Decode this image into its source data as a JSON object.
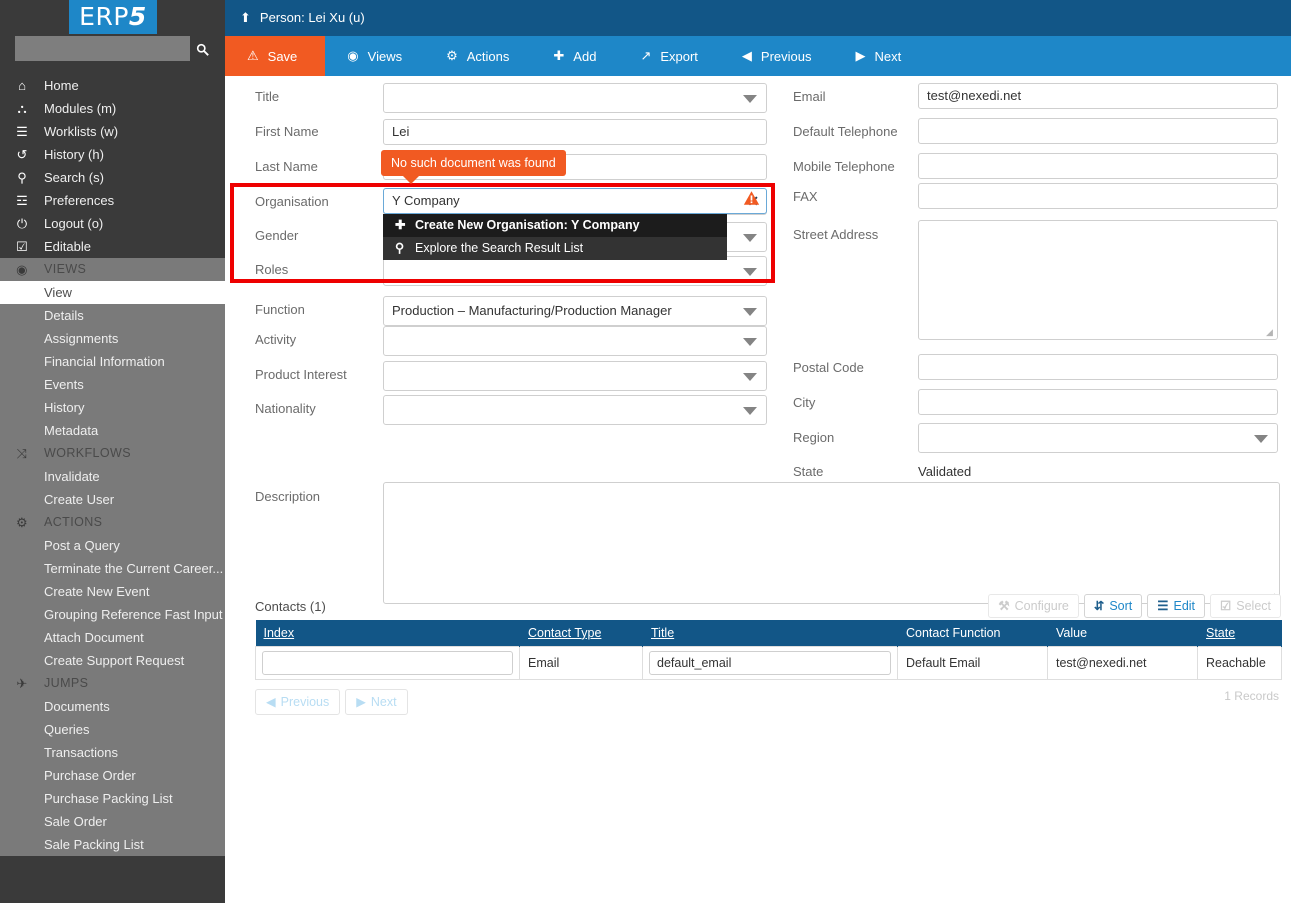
{
  "sidebar": {
    "logo": {
      "prefix": "ERP",
      "suffix": "5"
    },
    "search": {
      "value": "",
      "placeholder": "",
      "icon": "search-icon"
    },
    "nav": [
      {
        "label": "Home",
        "icon": "home-icon",
        "type": "item"
      },
      {
        "label": "Modules (m)",
        "icon": "modules-icon",
        "type": "item"
      },
      {
        "label": "Worklists (w)",
        "icon": "worklists-icon",
        "type": "item"
      },
      {
        "label": "History (h)",
        "icon": "history-icon",
        "type": "item"
      },
      {
        "label": "Search (s)",
        "icon": "search-icon",
        "type": "item"
      },
      {
        "label": "Preferences",
        "icon": "sliders-icon",
        "type": "item"
      },
      {
        "label": "Logout (o)",
        "icon": "power-icon",
        "type": "item"
      },
      {
        "label": "Editable",
        "icon": "checkbox-checked-icon",
        "type": "item"
      },
      {
        "label": "VIEWS",
        "icon": "eye-icon",
        "type": "section"
      },
      {
        "label": "View",
        "icon": "",
        "type": "active"
      },
      {
        "label": "Details",
        "icon": "",
        "type": "group"
      },
      {
        "label": "Assignments",
        "icon": "",
        "type": "group"
      },
      {
        "label": "Financial Information",
        "icon": "",
        "type": "group"
      },
      {
        "label": "Events",
        "icon": "",
        "type": "group"
      },
      {
        "label": "History",
        "icon": "",
        "type": "group"
      },
      {
        "label": "Metadata",
        "icon": "",
        "type": "group"
      },
      {
        "label": "WORKFLOWS",
        "icon": "workflow-icon",
        "type": "section"
      },
      {
        "label": "Invalidate",
        "icon": "",
        "type": "group"
      },
      {
        "label": "Create User",
        "icon": "",
        "type": "group"
      },
      {
        "label": "ACTIONS",
        "icon": "gears-icon",
        "type": "section"
      },
      {
        "label": "Post a Query",
        "icon": "",
        "type": "group"
      },
      {
        "label": "Terminate the Current Career...",
        "icon": "",
        "type": "group"
      },
      {
        "label": "Create New Event",
        "icon": "",
        "type": "group"
      },
      {
        "label": "Grouping Reference Fast Input",
        "icon": "",
        "type": "group"
      },
      {
        "label": "Attach Document",
        "icon": "",
        "type": "group"
      },
      {
        "label": "Create Support Request",
        "icon": "",
        "type": "group"
      },
      {
        "label": "JUMPS",
        "icon": "plane-icon",
        "type": "section"
      },
      {
        "label": "Documents",
        "icon": "",
        "type": "group"
      },
      {
        "label": "Queries",
        "icon": "",
        "type": "group"
      },
      {
        "label": "Transactions",
        "icon": "",
        "type": "group"
      },
      {
        "label": "Purchase Order",
        "icon": "",
        "type": "group"
      },
      {
        "label": "Purchase Packing List",
        "icon": "",
        "type": "group"
      },
      {
        "label": "Sale Order",
        "icon": "",
        "type": "group"
      },
      {
        "label": "Sale Packing List",
        "icon": "",
        "type": "group"
      }
    ]
  },
  "header": {
    "breadcrumb": "Person: Lei Xu (u)",
    "breadcrumb_icon": "up-arrow-icon"
  },
  "toolbar": [
    {
      "label": "Save",
      "icon": "warning-triangle-icon",
      "state": "active"
    },
    {
      "label": "Views",
      "icon": "eye-icon",
      "state": "normal"
    },
    {
      "label": "Actions",
      "icon": "gears-icon",
      "state": "normal"
    },
    {
      "label": "Add",
      "icon": "plus-icon",
      "state": "normal"
    },
    {
      "label": "Export",
      "icon": "export-icon",
      "state": "normal"
    },
    {
      "label": "Previous",
      "icon": "caret-left-icon",
      "state": "normal"
    },
    {
      "label": "Next",
      "icon": "caret-right-icon",
      "state": "normal"
    }
  ],
  "form": {
    "left": {
      "title": {
        "label": "Title",
        "value": ""
      },
      "first_name": {
        "label": "First Name",
        "value": "Lei"
      },
      "last_name": {
        "label": "Last Name",
        "value": ""
      },
      "organisation": {
        "label": "Organisation",
        "value": "Y Company"
      },
      "gender": {
        "label": "Gender",
        "value": ""
      },
      "roles": {
        "label": "Roles",
        "value": ""
      },
      "function": {
        "label": "Function",
        "value": "Production – Manufacturing/Production Manager"
      },
      "activity": {
        "label": "Activity",
        "value": ""
      },
      "product_interest": {
        "label": "Product Interest",
        "value": ""
      },
      "nationality": {
        "label": "Nationality",
        "value": ""
      },
      "description": {
        "label": "Description",
        "value": ""
      }
    },
    "right": {
      "email": {
        "label": "Email",
        "value": "test@nexedi.net"
      },
      "default_telephone": {
        "label": "Default Telephone",
        "value": ""
      },
      "mobile_telephone": {
        "label": "Mobile Telephone",
        "value": ""
      },
      "fax": {
        "label": "FAX",
        "value": ""
      },
      "street_address": {
        "label": "Street Address",
        "value": ""
      },
      "postal_code": {
        "label": "Postal Code",
        "value": ""
      },
      "city": {
        "label": "City",
        "value": ""
      },
      "region": {
        "label": "Region",
        "value": ""
      },
      "state": {
        "label": "State",
        "value": "Validated"
      }
    }
  },
  "tooltip": {
    "text": "No such document was found"
  },
  "autocomplete": {
    "clear_icon": "close-icon",
    "warning_icon": "warning-triangle-icon",
    "options": [
      {
        "label": "Create New Organisation: Y Company",
        "icon": "plus-icon"
      },
      {
        "label": "Explore the Search Result List",
        "icon": "search-icon"
      }
    ]
  },
  "list": {
    "title": "Contacts (1)",
    "tools": [
      {
        "label": "Configure",
        "icon": "wrench-icon",
        "state": "disabled"
      },
      {
        "label": "Sort",
        "icon": "sort-icon",
        "state": "enabled"
      },
      {
        "label": "Edit",
        "icon": "list-icon",
        "state": "enabled"
      },
      {
        "label": "Select",
        "icon": "checkbox-icon",
        "state": "disabled"
      }
    ],
    "columns": [
      {
        "label": "Index",
        "sortable": true
      },
      {
        "label": "Contact Type",
        "sortable": true
      },
      {
        "label": "Title",
        "sortable": true
      },
      {
        "label": "Contact Function",
        "sortable": false
      },
      {
        "label": "Value",
        "sortable": false
      },
      {
        "label": "State",
        "sortable": true
      }
    ],
    "rows": [
      {
        "index": "",
        "contact_type": "Email",
        "title": "default_email",
        "contact_function": "Default Email",
        "value": "test@nexedi.net",
        "state": "Reachable"
      }
    ],
    "pagination": {
      "previous": "Previous",
      "next": "Next",
      "previous_icon": "caret-left-icon",
      "next_icon": "caret-right-icon"
    },
    "record_count": "1 Records"
  },
  "colors": {
    "brand_blue": "#1e87c8",
    "dark_blue": "#125687",
    "orange": "#f15a22",
    "sidebar_dark": "#3a3a3a",
    "sidebar_group": "#7a7a7a",
    "highlight_red": "#ee0000"
  }
}
